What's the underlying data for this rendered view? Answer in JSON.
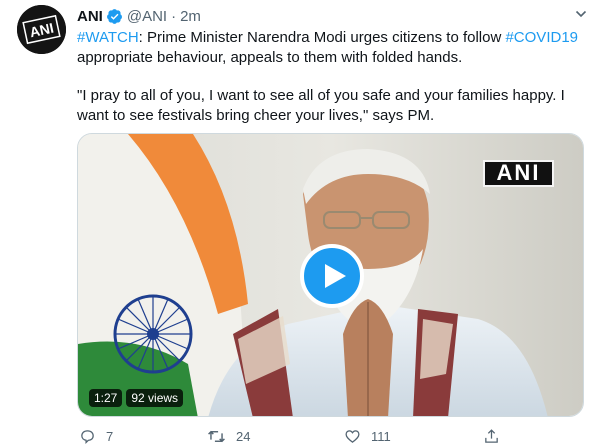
{
  "tweet": {
    "author": {
      "display_name": "ANI",
      "handle": "@ANI",
      "separator": "·",
      "time": "2m",
      "avatar_text": "ANI"
    },
    "text": {
      "line1_tag": "#WATCH",
      "line1_body": ": Prime Minister Narendra Modi urges citizens to follow ",
      "line1_tag2": "#COVID19",
      "line1_tail": " appropriate behaviour, appeals to them with folded hands.",
      "quote": "\"I pray to all of you, I want to see all of you safe and your families happy. I want to see festivals bring cheer your lives,\" says PM."
    },
    "video": {
      "watermark": "ANI",
      "duration": "1:27",
      "views": "92 views"
    },
    "actions": {
      "reply_count": "7",
      "retweet_count": "24",
      "like_count": "111"
    }
  },
  "colors": {
    "link": "#1d9bf0",
    "secondary": "#536471",
    "verified": "#1d9bf0",
    "saffron": "#f08a3a",
    "flag_green": "#2e8a3a",
    "chakra": "#1f3f8f"
  }
}
